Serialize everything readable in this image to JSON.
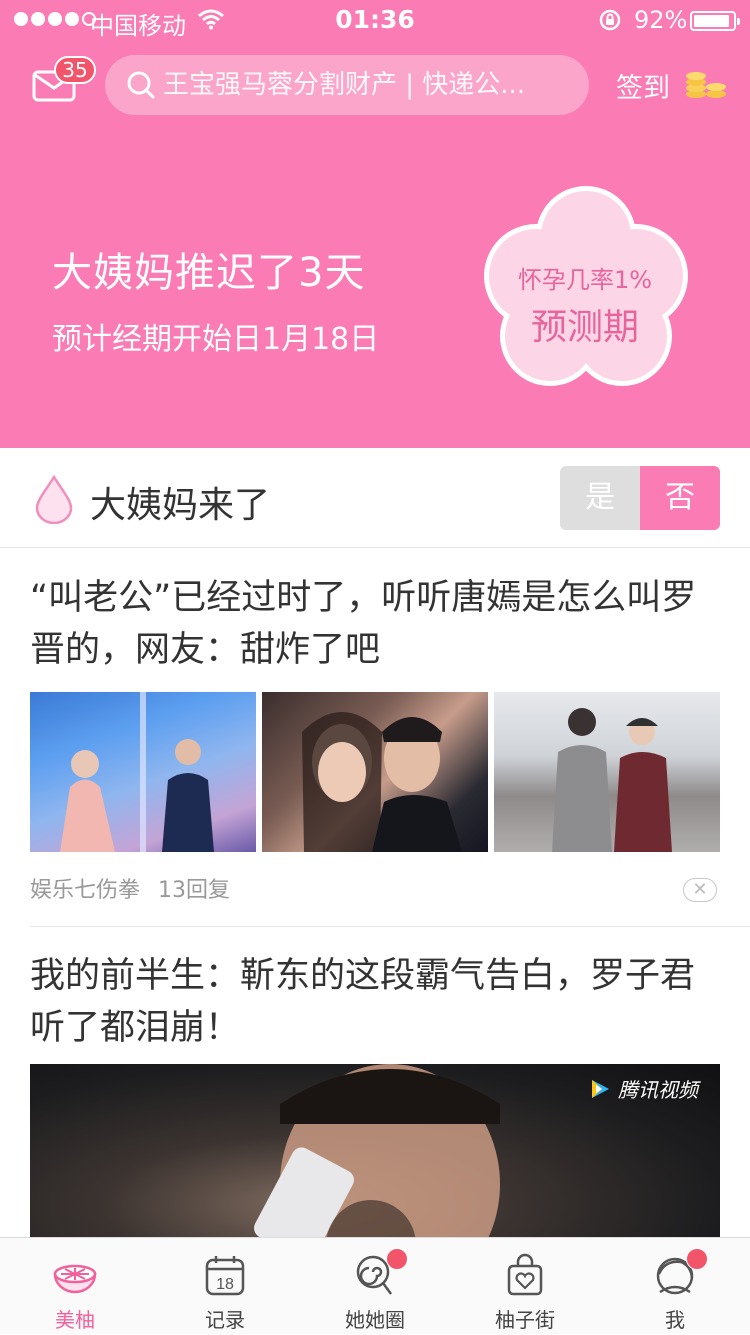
{
  "status_bar": {
    "carrier": "中国移动",
    "time": "01:36",
    "battery_pct": "92%",
    "battery_level": 0.92
  },
  "header": {
    "mail_badge": "35",
    "search_placeholder": "王宝强马蓉分割财产 | 快递公...",
    "checkin_label": "签到",
    "period_main": "大姨妈推迟了3天",
    "period_sub": "预计经期开始日1月18日",
    "flower_line1": "怀孕几率1%",
    "flower_line2": "预测期",
    "accent_color": "#fb7bb4"
  },
  "period_toggle": {
    "label": "大姨妈来了",
    "yes": "是",
    "no": "否",
    "selected": "否"
  },
  "feed": [
    {
      "title": "“叫老公”已经过时了，听听唐嫣是怎么叫罗晋的，网友：甜炸了吧",
      "source": "娱乐七伤拳",
      "replies": "13回复"
    },
    {
      "title": "我的前半生：靳东的这段霸气告白，罗子君听了都泪崩！",
      "video_logo": "腾讯视频"
    }
  ],
  "tabs": [
    {
      "label": "美柚",
      "icon": "grapefruit-icon",
      "active": true
    },
    {
      "label": "记录",
      "icon": "calendar-icon",
      "calendar_day": "18"
    },
    {
      "label": "她她圈",
      "icon": "lollipop-icon",
      "dot": true
    },
    {
      "label": "柚子街",
      "icon": "shopping-bag-icon"
    },
    {
      "label": "我",
      "icon": "profile-icon",
      "dot": true
    }
  ]
}
